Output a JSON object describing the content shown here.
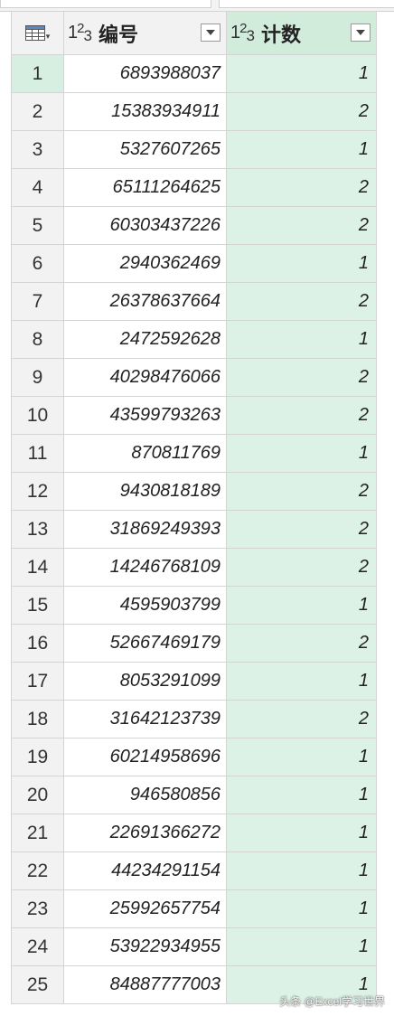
{
  "columns": [
    {
      "type_label": "1",
      "type_label_sub": "3",
      "name": "编号"
    },
    {
      "type_label": "1",
      "type_label_sub": "3",
      "name": "计数"
    }
  ],
  "rows": [
    {
      "index": "1",
      "bh": "6893988037",
      "js": "1"
    },
    {
      "index": "2",
      "bh": "15383934911",
      "js": "2"
    },
    {
      "index": "3",
      "bh": "5327607265",
      "js": "1"
    },
    {
      "index": "4",
      "bh": "65111264625",
      "js": "2"
    },
    {
      "index": "5",
      "bh": "60303437226",
      "js": "2"
    },
    {
      "index": "6",
      "bh": "2940362469",
      "js": "1"
    },
    {
      "index": "7",
      "bh": "26378637664",
      "js": "2"
    },
    {
      "index": "8",
      "bh": "2472592628",
      "js": "1"
    },
    {
      "index": "9",
      "bh": "40298476066",
      "js": "2"
    },
    {
      "index": "10",
      "bh": "43599793263",
      "js": "2"
    },
    {
      "index": "11",
      "bh": "870811769",
      "js": "1"
    },
    {
      "index": "12",
      "bh": "9430818189",
      "js": "2"
    },
    {
      "index": "13",
      "bh": "31869249393",
      "js": "2"
    },
    {
      "index": "14",
      "bh": "14246768109",
      "js": "2"
    },
    {
      "index": "15",
      "bh": "4595903799",
      "js": "1"
    },
    {
      "index": "16",
      "bh": "52667469179",
      "js": "2"
    },
    {
      "index": "17",
      "bh": "8053291099",
      "js": "1"
    },
    {
      "index": "18",
      "bh": "31642123739",
      "js": "2"
    },
    {
      "index": "19",
      "bh": "60214958696",
      "js": "1"
    },
    {
      "index": "20",
      "bh": "946580856",
      "js": "1"
    },
    {
      "index": "21",
      "bh": "22691366272",
      "js": "1"
    },
    {
      "index": "22",
      "bh": "44234291154",
      "js": "1"
    },
    {
      "index": "23",
      "bh": "25992657754",
      "js": "1"
    },
    {
      "index": "24",
      "bh": "53922934955",
      "js": "1"
    },
    {
      "index": "25",
      "bh": "84887777003",
      "js": "1"
    }
  ],
  "watermark": "头条 @Excel学习世界",
  "colors": {
    "selected_column": "#ddf2e6",
    "active_row_index": "#d6efe0",
    "header": "#f2f2f2"
  }
}
